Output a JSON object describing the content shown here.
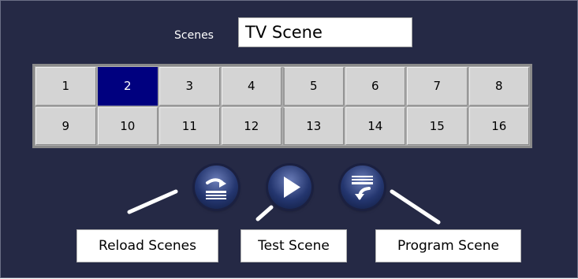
{
  "scenes": {
    "label": "Scenes",
    "value": "TV Scene"
  },
  "grid": {
    "selected": "2",
    "buttons": [
      "1",
      "2",
      "3",
      "4",
      "5",
      "6",
      "7",
      "8",
      "9",
      "10",
      "11",
      "12",
      "13",
      "14",
      "15",
      "16"
    ]
  },
  "actions": {
    "reload_icon": "reload-scenes-icon",
    "test_icon": "play-icon",
    "program_icon": "program-scene-icon"
  },
  "callouts": {
    "reload": "Reload Scenes",
    "test": "Test Scene",
    "program": "Program Scene"
  },
  "colors": {
    "panel_bg": "#252945",
    "selected_bg": "#00007f",
    "cell_bg": "#d4d4d4"
  }
}
